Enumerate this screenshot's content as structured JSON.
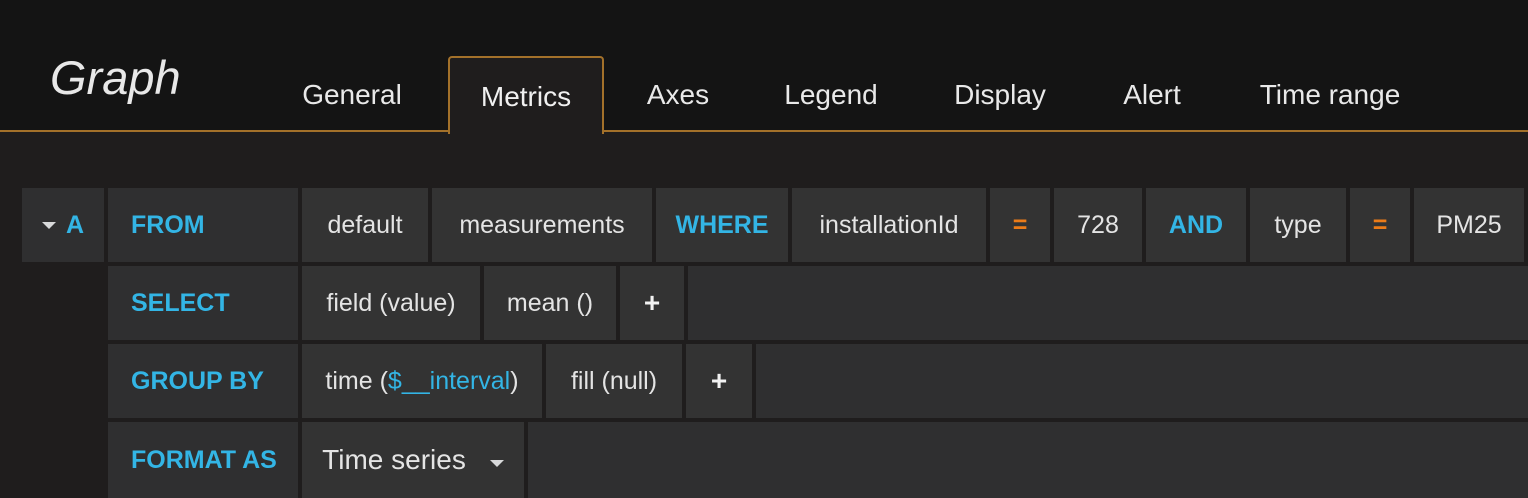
{
  "panel": {
    "title": "Graph"
  },
  "tabs": [
    {
      "label": "General"
    },
    {
      "label": "Metrics"
    },
    {
      "label": "Axes"
    },
    {
      "label": "Legend"
    },
    {
      "label": "Display"
    },
    {
      "label": "Alert"
    },
    {
      "label": "Time range"
    }
  ],
  "active_tab": "Metrics",
  "query": {
    "ref_id": "A",
    "from": {
      "keyword": "FROM",
      "policy": "default",
      "measurement": "measurements",
      "where_keyword": "WHERE",
      "conditions": [
        {
          "key": "installationId",
          "operator": "=",
          "value": "728"
        },
        {
          "conjunction": "AND",
          "key": "type",
          "operator": "=",
          "value": "PM25"
        }
      ]
    },
    "select": {
      "keyword": "SELECT",
      "field": "field (value)",
      "aggregation": "mean ()",
      "add": "+"
    },
    "group_by": {
      "keyword": "GROUP BY",
      "time_prefix": "time (",
      "time_var": "$__interval",
      "time_suffix": ")",
      "fill": "fill (null)",
      "add": "+"
    },
    "format_as": {
      "keyword": "FORMAT AS",
      "value": "Time series"
    }
  },
  "colors": {
    "accent_orange": "#a3712a",
    "keyword_blue": "#33b5e5",
    "operator_orange": "#eb7b18"
  }
}
